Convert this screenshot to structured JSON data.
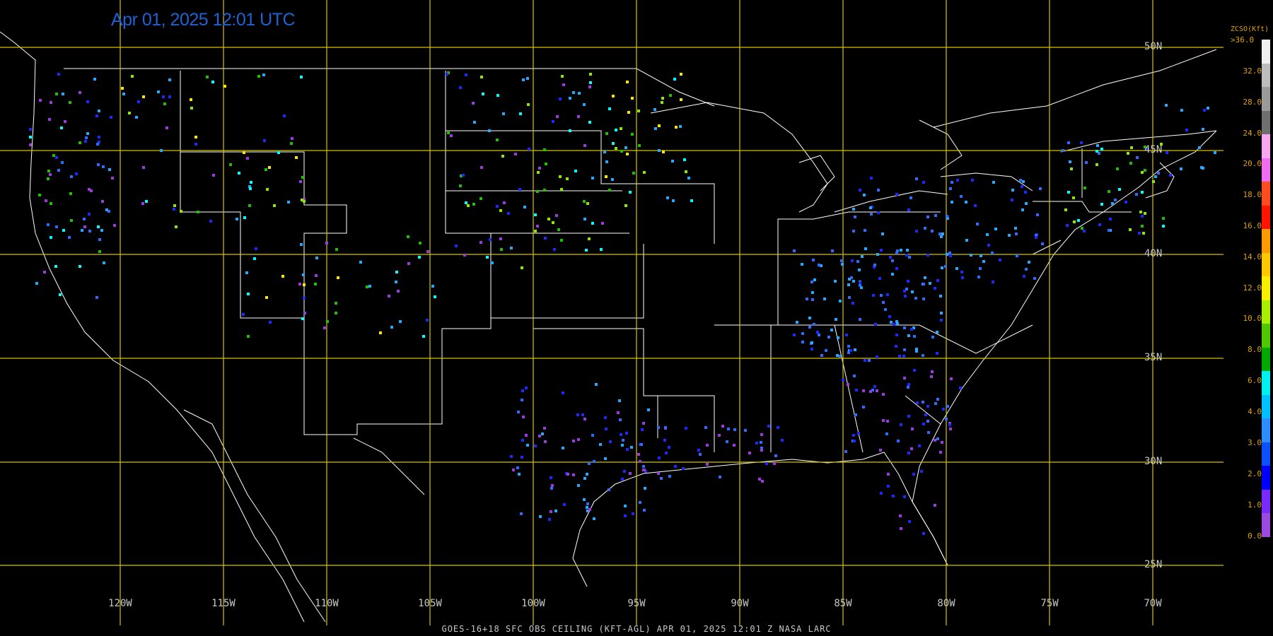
{
  "header": {
    "title": "Apr 01, 2025 12:01 UTC"
  },
  "footer": {
    "caption": "GOES-16+18  SFC OBS CEILING (KFT-AGL)   APR 01, 2025 12:01 Z   NASA LARC"
  },
  "map": {
    "latitude_labels": [
      "50N",
      "45N",
      "40N",
      "35N",
      "30N",
      "25N"
    ],
    "longitude_labels": [
      "120W",
      "115W",
      "110W",
      "105W",
      "100W",
      "95W",
      "90W",
      "85W",
      "80W",
      "75W",
      "70W"
    ],
    "grid_color": "#d4c400",
    "boundary_color": "#ffffff"
  },
  "legend": {
    "title": "ZCSO(Kft)",
    "top_label": ">36.0",
    "labels": [
      "32.0",
      "28.0",
      "24.0",
      "20.0",
      "18.0",
      "16.0",
      "14.0",
      "12.0",
      "10.0",
      "8.0",
      "6.0",
      "4.0",
      "3.0",
      "2.0",
      "1.0",
      "0.0"
    ],
    "colors": [
      "#f0f0f0",
      "#bdbdbd",
      "#9a9a9a",
      "#6f6f6f",
      "#f7a8f0",
      "#f06cf0",
      "#ff4b20",
      "#ff1400",
      "#ff9a00",
      "#ffc800",
      "#f8f000",
      "#a8f000",
      "#50c800",
      "#00a800",
      "#00f0f0",
      "#00c0ff",
      "#2d8cff",
      "#0d50ff",
      "#0000ff",
      "#7a2aff",
      "#9a4ae0"
    ]
  },
  "observations": {
    "category_colors": {
      "lt1": "#9a3ae0",
      "c1_2": "#1c28ff",
      "c2_3": "#2d6cff",
      "c3_4": "#23aaff",
      "c4_6": "#00ffff",
      "c6_8": "#20c000",
      "c8_10": "#8ce800",
      "c10_12": "#ffe600",
      "c12_14": "#ff9a00",
      "c16_18": "#ff3000",
      "c20_24": "#ff60ff",
      "c24_28": "#888888"
    }
  }
}
